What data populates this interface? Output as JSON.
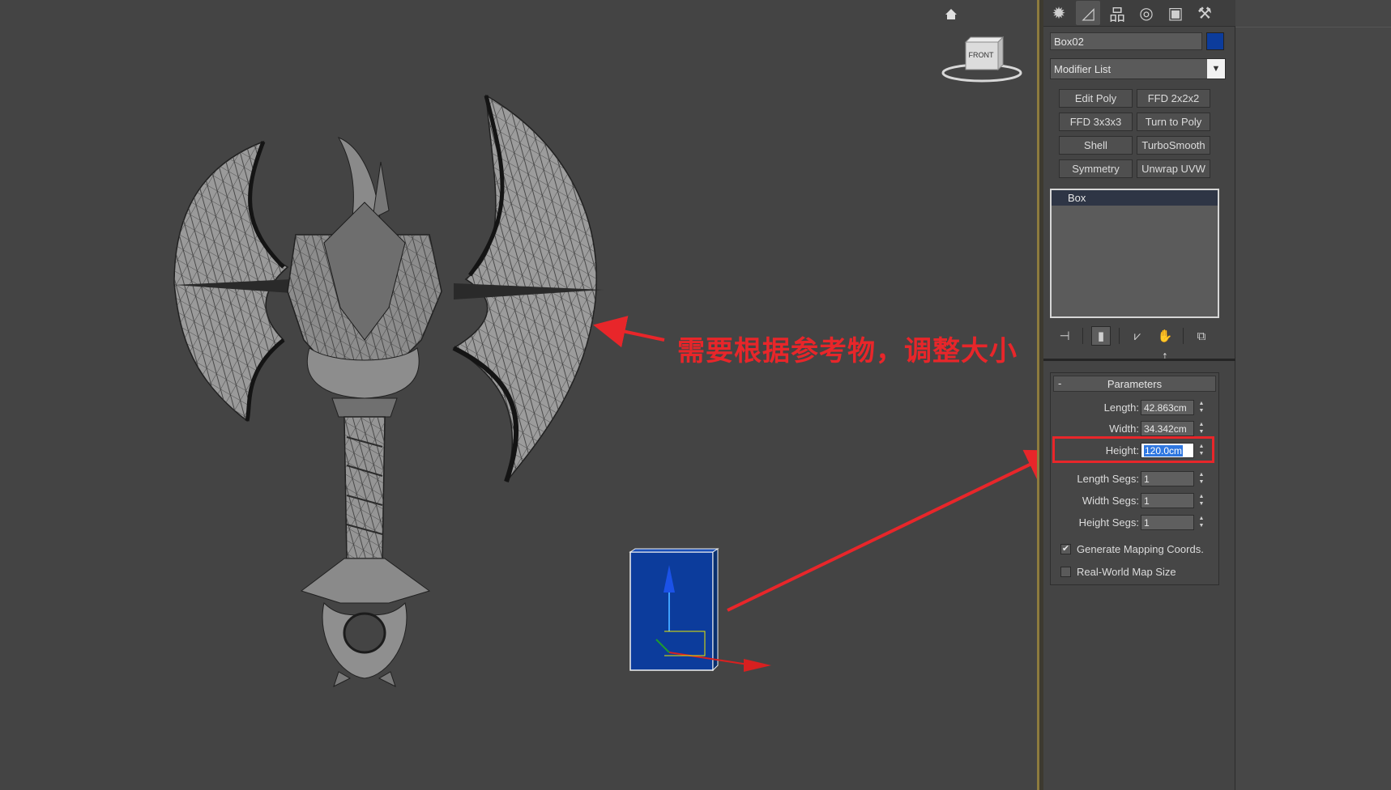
{
  "viewport": {
    "annotation_text": "需要根据参考物，调整大小",
    "viewcube_label": "FRONT",
    "annotation_color": "#e8262a",
    "box_color": "#0c3c9c"
  },
  "panel": {
    "tabs": [
      {
        "name": "create-tab",
        "glyph": "✹"
      },
      {
        "name": "modify-tab",
        "glyph": "◿"
      },
      {
        "name": "hierarchy-tab",
        "glyph": "品"
      },
      {
        "name": "motion-tab",
        "glyph": "◎"
      },
      {
        "name": "display-tab",
        "glyph": "▣"
      },
      {
        "name": "utilities-tab",
        "glyph": "⚒"
      }
    ],
    "object_name": "Box02",
    "object_color": "#0c3c9c",
    "modifier_list": "Modifier List",
    "modifier_buttons": [
      "Edit Poly",
      "FFD 2x2x2",
      "FFD 3x3x3",
      "Turn to Poly",
      "Shell",
      "TurboSmooth",
      "Symmetry",
      "Unwrap UVW"
    ],
    "stack_items": [
      "Box"
    ],
    "parameters": {
      "title": "Parameters",
      "collapse": "-",
      "length_label": "Length:",
      "length_value": "42.863cm",
      "width_label": "Width:",
      "width_value": "34.342cm",
      "height_label": "Height:",
      "height_value": "120.0cm",
      "length_segs_label": "Length Segs:",
      "length_segs_value": "1",
      "width_segs_label": "Width Segs:",
      "width_segs_value": "1",
      "height_segs_label": "Height Segs:",
      "height_segs_value": "1",
      "gen_mapping_label": "Generate Mapping Coords.",
      "gen_mapping_checked": "✔",
      "real_world_label": "Real-World Map Size"
    }
  }
}
